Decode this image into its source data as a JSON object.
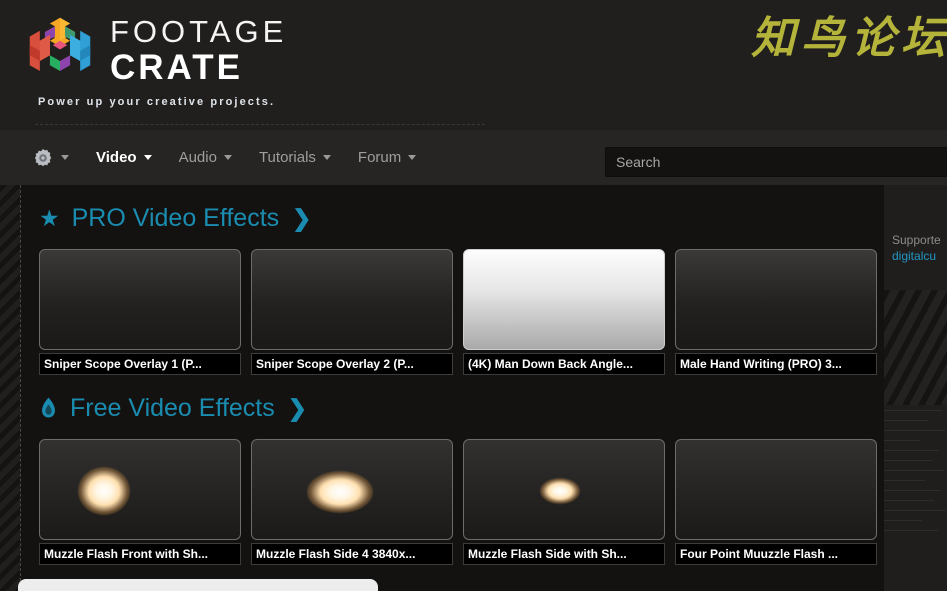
{
  "site": {
    "brand_line1": "FOOTAGE",
    "brand_line2": "CRATE",
    "tagline": "Power up your creative projects.",
    "watermark": "知鸟论坛",
    "accent_color": "#1a8cb0",
    "link_color": "#2196c4"
  },
  "nav": {
    "gear_icon": "gear-icon",
    "items": [
      {
        "label": "Video",
        "active": true
      },
      {
        "label": "Audio",
        "active": false
      },
      {
        "label": "Tutorials",
        "active": false
      },
      {
        "label": "Forum",
        "active": false
      }
    ]
  },
  "search": {
    "placeholder": "Search",
    "value": ""
  },
  "sections": [
    {
      "id": "pro-video-effects",
      "icon": "star-icon",
      "icon_glyph": "★",
      "title": "PRO Video Effects",
      "arrow": "❯",
      "cards": [
        {
          "caption": "Sniper Scope Overlay 1 (P...",
          "style": "dark"
        },
        {
          "caption": "Sniper Scope Overlay 2 (P...",
          "style": "dark"
        },
        {
          "caption": "(4K) Man Down Back Angle...",
          "style": "bright"
        },
        {
          "caption": "Male Hand Writing (PRO) 3...",
          "style": "dark"
        }
      ]
    },
    {
      "id": "free-video-effects",
      "icon": "flame-icon",
      "icon_glyph": "",
      "title": "Free Video Effects",
      "arrow": "❯",
      "cards": [
        {
          "caption": "Muzzle Flash Front with Sh...",
          "style": "flash"
        },
        {
          "caption": "Muzzle Flash Side 4 3840x...",
          "style": "flash"
        },
        {
          "caption": "Muzzle Flash Side with Sh...",
          "style": "flash"
        },
        {
          "caption": "Four Point Muuzzle Flash ...",
          "style": "flash"
        }
      ]
    }
  ],
  "rail": {
    "support_text": "Supporte",
    "link_text": "digitalcu"
  }
}
